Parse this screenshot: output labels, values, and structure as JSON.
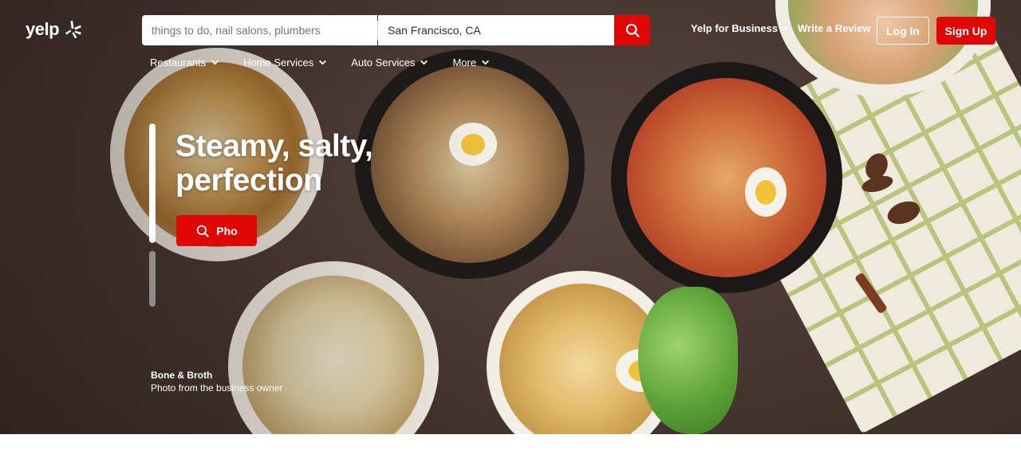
{
  "brand": {
    "name": "yelp"
  },
  "search": {
    "find_placeholder": "things to do, nail salons, plumbers",
    "near_value": "San Francisco, CA"
  },
  "header": {
    "for_business": "Yelp for Business",
    "write_review": "Write a Review",
    "login": "Log In",
    "signup": "Sign Up"
  },
  "categories": [
    {
      "label": "Restaurants"
    },
    {
      "label": "Home Services"
    },
    {
      "label": "Auto Services"
    },
    {
      "label": "More"
    }
  ],
  "hero": {
    "headline_line1": "Steamy, salty,",
    "headline_line2": "perfection",
    "cta_label": "Pho",
    "slides_total": 3,
    "slide_active": 1
  },
  "credit": {
    "business": "Bone & Broth",
    "note": "Photo from the business owner"
  },
  "colors": {
    "brand_red": "#e00707",
    "hero_bg": "#4a3833",
    "text_light": "#ffffff"
  }
}
